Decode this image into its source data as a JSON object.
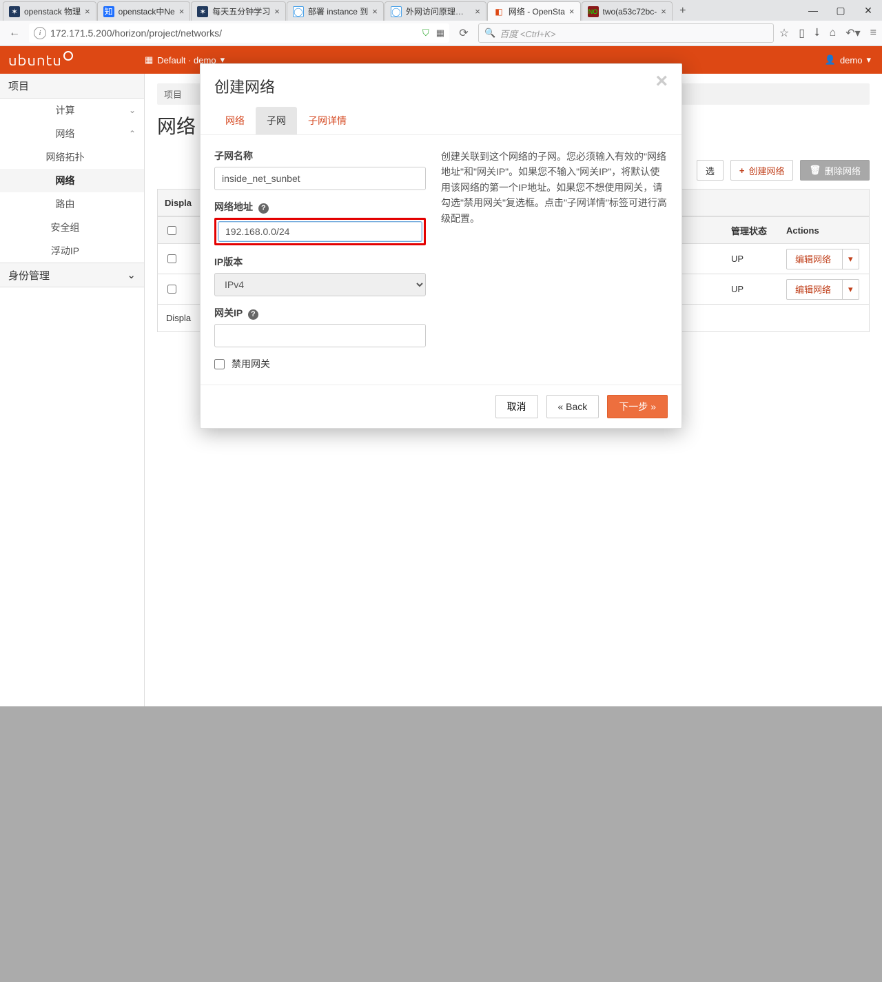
{
  "browser": {
    "tabs": [
      {
        "title": "openstack 物理"
      },
      {
        "title": "openstack中Ne"
      },
      {
        "title": "每天五分钟学习"
      },
      {
        "title": "部署 instance 到"
      },
      {
        "title": "外网访问原理分析"
      },
      {
        "title": "网络 - OpenSta"
      },
      {
        "title": "two(a53c72bc-"
      }
    ],
    "url": "172.171.5.200/horizon/project/networks/",
    "search_placeholder": "百度 <Ctrl+K>"
  },
  "header": {
    "context": "Default · demo",
    "user": "demo"
  },
  "sidebar": {
    "project": "项目",
    "compute": "计算",
    "network": "网络",
    "items": {
      "topology": "网络拓扑",
      "networks": "网络",
      "routes": "路由",
      "secgroups": "安全组",
      "floating": "浮动IP"
    },
    "identity": "身份管理"
  },
  "page": {
    "breadcrumb": "项目",
    "title": "网络",
    "display_prefix": "Displa",
    "display_footer": "Displa",
    "filter_btn": "选",
    "create_btn": "创建网络",
    "delete_btn": "删除网络",
    "columns": {
      "status": "管理状态",
      "actions": "Actions"
    },
    "rows": [
      {
        "status": "UP",
        "edit": "编辑网络"
      },
      {
        "status": "UP",
        "edit": "编辑网络"
      }
    ]
  },
  "modal": {
    "title": "创建网络",
    "tabs": {
      "network": "网络",
      "subnet": "子网",
      "details": "子网详情"
    },
    "form": {
      "subnet_name_label": "子网名称",
      "subnet_name_value": "inside_net_sunbet",
      "cidr_label": "网络地址",
      "cidr_value": "192.168.0.0/24",
      "ip_version_label": "IP版本",
      "ip_version_value": "IPv4",
      "gateway_label": "网关IP",
      "gateway_value": "",
      "disable_gateway_label": "禁用网关"
    },
    "help": "创建关联到这个网络的子网。您必须输入有效的\"网络地址\"和\"网关IP\"。如果您不输入\"网关IP\"，将默认使用该网络的第一个IP地址。如果您不想使用网关，请勾选\"禁用网关\"复选框。点击\"子网详情\"标签可进行高级配置。",
    "buttons": {
      "cancel": "取消",
      "back": "«  Back",
      "next": "下一步  »"
    }
  }
}
